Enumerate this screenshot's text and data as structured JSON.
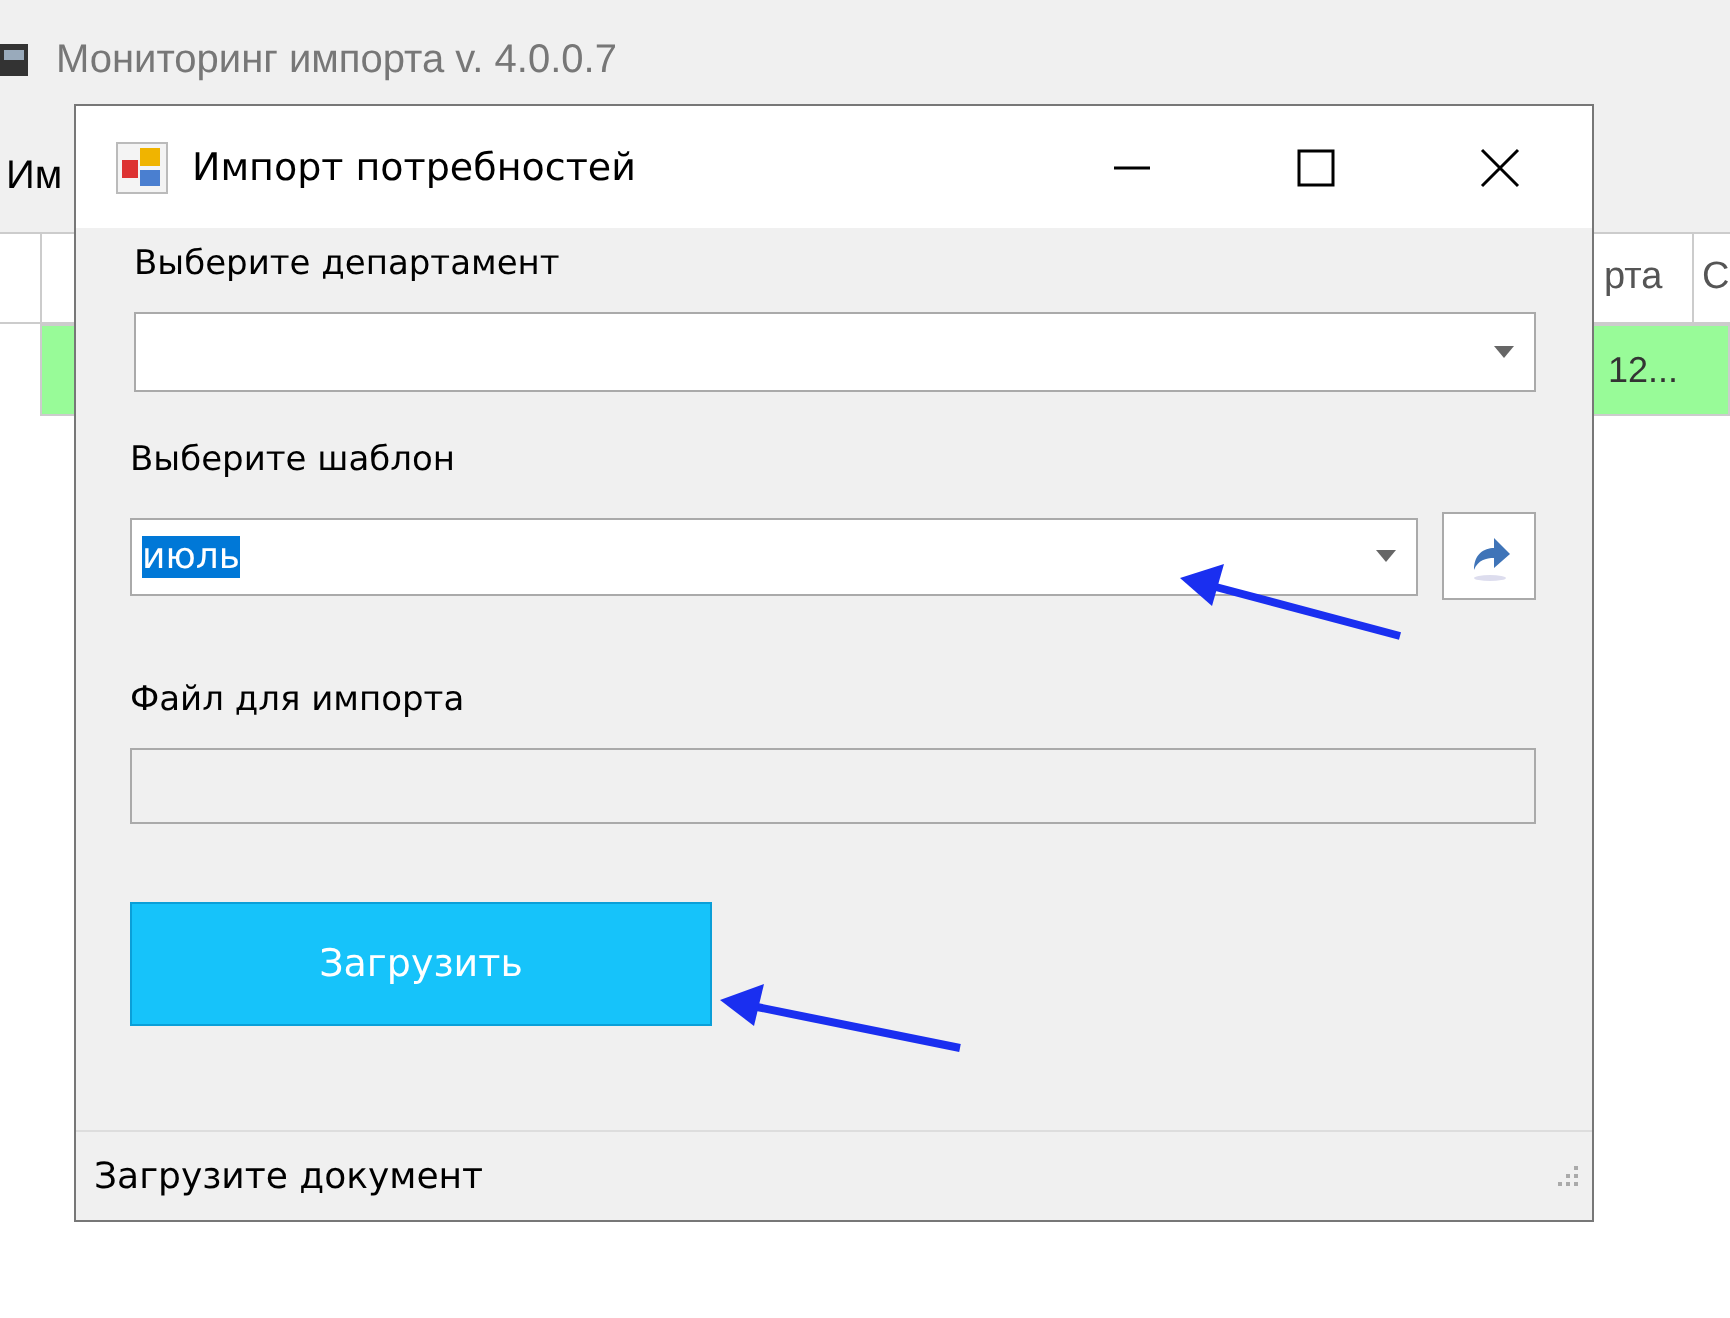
{
  "background_window": {
    "title": "Мониторинг импорта v. 4.0.0.7",
    "menu": [
      "Им"
    ],
    "table": {
      "columns": [
        "рта",
        "С"
      ],
      "row_cells": [
        "12..."
      ]
    }
  },
  "dialog": {
    "title": "Импорт потребностей",
    "department": {
      "label": "Выберите департамент"
    },
    "template": {
      "label": "Выберите шаблон",
      "value": "июль",
      "text_selected": true
    },
    "file": {
      "label": "Файл для импорта",
      "disabled": true
    },
    "button": "Загрузить",
    "status": "Загрузите документ"
  }
}
